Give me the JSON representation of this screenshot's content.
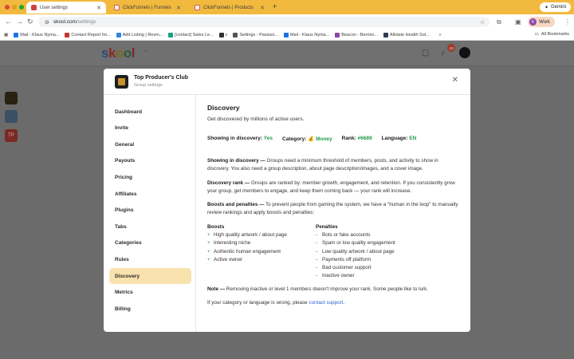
{
  "browser": {
    "tabs": [
      {
        "label": "User settings",
        "active": true
      },
      {
        "label": "ClickFunnels | Funnels",
        "active": false
      },
      {
        "label": "ClickFunnels | Products",
        "active": false
      }
    ],
    "gemini_label": "Gemini",
    "url_host": "skool.com",
    "url_path": "/settings",
    "profile_label": "Work",
    "profile_initial": "K",
    "bookmarks": [
      {
        "label": "Mail - Klaus Nyma...",
        "color": "#1a73e8"
      },
      {
        "label": "Contact Report for...",
        "color": "#c0392b"
      },
      {
        "label": "Add Listing | Revm...",
        "color": "#2e86de"
      },
      {
        "label": "[contact] Sales Le...",
        "color": "#16a085"
      },
      {
        "label": "c",
        "color": "#333333"
      },
      {
        "label": "Settings - Passwo...",
        "color": "#555555"
      },
      {
        "label": "Mail - Klaus Nyma...",
        "color": "#1a73e8"
      },
      {
        "label": "Beacon - Berrien...",
        "color": "#8e44ad"
      },
      {
        "label": "Allstate Health Sol...",
        "color": "#2c3e50"
      }
    ],
    "all_bookmarks": "All Bookmarks"
  },
  "app": {
    "logo_letters": [
      "s",
      "k",
      "o",
      "o",
      "l"
    ],
    "notification_count": "13",
    "side_tile_label": "TP"
  },
  "modal": {
    "group_name": "Top Producer's Club",
    "group_subtitle": "Group settings",
    "nav": [
      "Dashboard",
      "Invite",
      "General",
      "Payouts",
      "Pricing",
      "Affiliates",
      "Plugins",
      "Tabs",
      "Categories",
      "Rules",
      "Discovery",
      "Metrics",
      "Billing"
    ],
    "active_nav": "Discovery",
    "content": {
      "title": "Discovery",
      "subtitle": "Get discovered by millions of active users.",
      "status": {
        "showing_label": "Showing in discovery:",
        "showing_value": "Yes",
        "category_label": "Category:",
        "category_value": "💰 Money",
        "rank_label": "Rank:",
        "rank_value": "#6689",
        "language_label": "Language:",
        "language_value": "EN"
      },
      "showing_heading": "Showing in discovery —",
      "showing_text": "Groups need a minimum threshold of members, posts, and activity to show in discovery. You also need a group description, about page description/images, and a cover image.",
      "rank_heading": "Discovery rank —",
      "rank_text": "Groups are ranked by: member growth, engagement, and retention. If you consistently grow your group, get members to engage, and keep them coming back — your rank will increase.",
      "boosts_heading": "Boosts and penalties —",
      "boosts_text": "To prevent people from gaming the system, we have a \"human in the loop\" to manually review rankings and apply boosts and penalties:",
      "boosts_title": "Boosts",
      "boosts": [
        "High quality artwork / about page",
        "Interesting niche",
        "Authentic human engagement",
        "Active owner"
      ],
      "penalties_title": "Penalties",
      "penalties": [
        "Bots or fake accounts",
        "Spam or low quality engagement",
        "Low quality artwork / about page",
        "Payments off platform",
        "Bad customer support",
        "Inactive owner"
      ],
      "note_heading": "Note —",
      "note_text": "Removing inactive or level 1 members doesn't improve your rank. Some people like to lurk.",
      "wrong_text": "If your category or language is wrong, please",
      "support_link": "contact support",
      "wrong_end": "."
    }
  },
  "colors": {
    "chrome": "#f1b93e",
    "accent_nav": "#f9e2ad",
    "green": "#1f9a4b",
    "link": "#2b6ad3",
    "overlay": "#6b6b6b"
  }
}
